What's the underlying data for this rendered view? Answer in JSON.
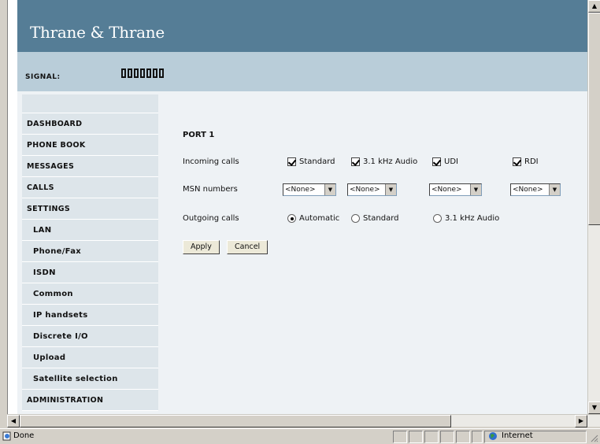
{
  "brand": "Thrane & Thrane",
  "signal": {
    "label": "SIGNAL:",
    "bars": 7
  },
  "nav": [
    {
      "label": "DASHBOARD",
      "level": "top"
    },
    {
      "label": "PHONE BOOK",
      "level": "top"
    },
    {
      "label": "MESSAGES",
      "level": "top"
    },
    {
      "label": "CALLS",
      "level": "top"
    },
    {
      "label": "SETTINGS",
      "level": "top"
    },
    {
      "label": "LAN",
      "level": "sub"
    },
    {
      "label": "Phone/Fax",
      "level": "sub"
    },
    {
      "label": "ISDN",
      "level": "sub"
    },
    {
      "label": "Common",
      "level": "sub"
    },
    {
      "label": "IP handsets",
      "level": "sub"
    },
    {
      "label": "Discrete I/O",
      "level": "sub"
    },
    {
      "label": "Upload",
      "level": "sub"
    },
    {
      "label": "Satellite selection",
      "level": "sub"
    },
    {
      "label": "ADMINISTRATION",
      "level": "top"
    }
  ],
  "form": {
    "title": "PORT 1",
    "incoming": {
      "label": "Incoming calls",
      "options": [
        {
          "label": "Standard",
          "checked": true
        },
        {
          "label": "3.1 kHz Audio",
          "checked": true
        },
        {
          "label": "UDI",
          "checked": true
        },
        {
          "label": "RDI",
          "checked": true
        }
      ]
    },
    "msn": {
      "label": "MSN numbers",
      "selects": [
        "<None>",
        "<None>",
        "<None>",
        "<None>"
      ]
    },
    "outgoing": {
      "label": "Outgoing calls",
      "options": [
        {
          "label": "Automatic",
          "checked": true
        },
        {
          "label": "Standard",
          "checked": false
        },
        {
          "label": "3.1 kHz Audio",
          "checked": false
        }
      ]
    },
    "apply": "Apply",
    "cancel": "Cancel"
  },
  "status": {
    "text": "Done",
    "zone": "Internet"
  }
}
